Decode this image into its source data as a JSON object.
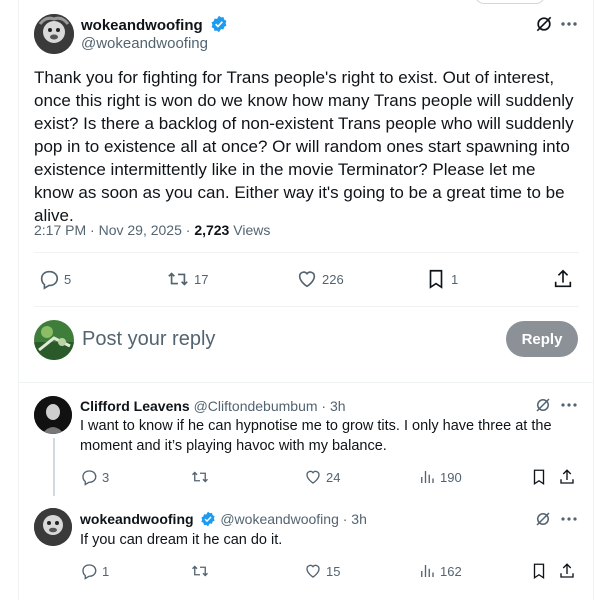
{
  "main": {
    "name": "wokeandwoofing",
    "handle": "@wokeandwoofing",
    "text": "Thank you for fighting for Trans people's right to exist. Out of interest, once this right is won do we know how many Trans people will suddenly exist? Is there a backlog of non-existent Trans people who will suddenly pop in to existence all at once? Or will random ones start spawning into existence intermittently like in the movie Terminator? Please let me know as soon as you can. Either way it's going to be a great time to be alive.",
    "time": "2:17 PM · Nov 29, 2025 · ",
    "views_count": "2,723",
    "views_label": " Views",
    "replies": "5",
    "reposts": "17",
    "likes": "226",
    "bookmarks": "1"
  },
  "reply_box": {
    "placeholder": "Post your reply",
    "button": "Reply"
  },
  "replies": [
    {
      "name": "Clifford Leavens",
      "handle": " @Cliftondebumbum · 3h",
      "text": "I want to know if he can hypnotise me to grow tits. I only have three at the moment and it’s playing havoc with my balance.",
      "replies": "3",
      "likes": "24",
      "views": "190"
    },
    {
      "name": "wokeandwoofing",
      "handle": " @wokeandwoofing · 3h",
      "text": "If you can dream it he can do it.",
      "replies": "1",
      "likes": "15",
      "views": "162"
    }
  ],
  "icons": {
    "grok": "grok-icon",
    "more": "more-icon",
    "reply": "reply-icon",
    "repost": "repost-icon",
    "like": "heart-icon",
    "bookmark": "bookmark-icon",
    "share": "share-icon",
    "views": "views-icon",
    "verified": "verified-icon"
  },
  "colors": {
    "verified": "#1d9bf0",
    "reply_button": "#8b9196",
    "secondary_text": "#536471"
  }
}
